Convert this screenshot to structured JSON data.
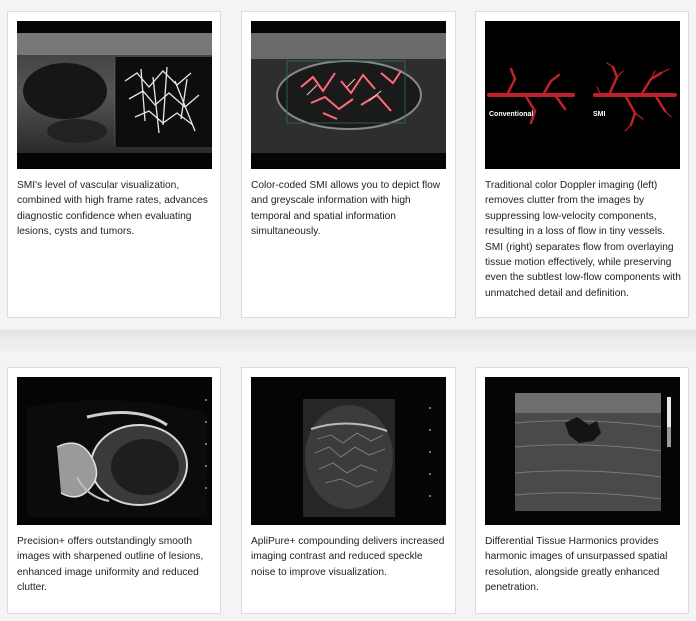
{
  "cards": [
    {
      "caption": "SMI's level of vascular visualization, combined with high frame rates, advances diagnostic confidence when evaluating lesions, cysts and tumors.",
      "image": "ultrasound-smi-greyscale-vessels"
    },
    {
      "caption": "Color-coded SMI allows you to depict flow and greyscale information with high temporal and spatial information simultaneously.",
      "image": "ultrasound-color-coded-smi"
    },
    {
      "caption": "Traditional color Doppler imaging (left) removes clutter from the images by suppressing low-velocity components, resulting in a loss of flow in tiny vessels. SMI (right) separates flow from overlaying tissue motion effectively, while preserving even the subtlest low-flow components with unmatched detail and definition.",
      "image": "vessel-tree-comparison",
      "image_labels": {
        "left": "Conventional",
        "right": "SMI"
      }
    },
    {
      "caption": "Precision+ offers outstandingly smooth images with sharpened outline of lesions, enhanced image uniformity and reduced clutter.",
      "image": "ultrasound-fetal-profile"
    },
    {
      "caption": "ApliPure+ compounding delivers increased imaging contrast and reduced speckle noise to improve visualization.",
      "image": "ultrasound-aplipure-compounding"
    },
    {
      "caption": "Differential Tissue Harmonics provides harmonic images of unsurpassed spatial resolution, alongside greatly enhanced penetration.",
      "image": "ultrasound-tissue-harmonics-lesion"
    }
  ],
  "colors": {
    "vessel_red": "#c0202a",
    "flow_pink": "#ff6b7a"
  }
}
